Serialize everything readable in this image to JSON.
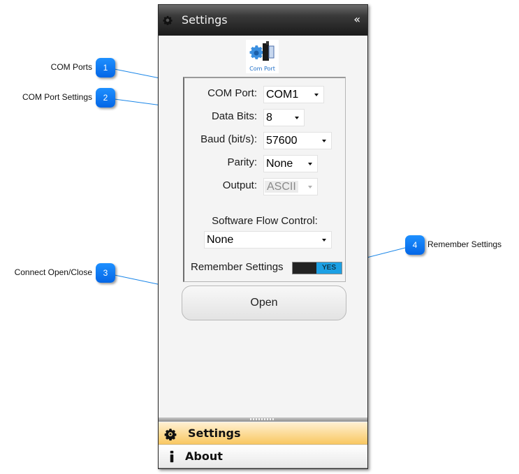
{
  "window": {
    "title": "Settings",
    "collapse_glyph": "«",
    "logo_caption": "Com Port",
    "logo_icon": "com-port-gear-icon"
  },
  "form": {
    "com_port": {
      "label": "COM Port:",
      "value": "COM1"
    },
    "data_bits": {
      "label": "Data Bits:",
      "value": "8"
    },
    "baud": {
      "label": "Baud (bit/s):",
      "value": "57600"
    },
    "parity": {
      "label": "Parity:",
      "value": "None"
    },
    "output": {
      "label": "Output:",
      "value": "ASCII",
      "disabled": true
    },
    "software_flow_control": {
      "label": "Software Flow Control:",
      "value": "None"
    },
    "remember_settings": {
      "label": "Remember Settings",
      "state": "YES"
    }
  },
  "open_button": {
    "label": "Open"
  },
  "nav": {
    "items": [
      {
        "label": "Settings",
        "icon": "gear-icon",
        "active": true
      },
      {
        "label": "About",
        "icon": "info-icon",
        "active": false
      }
    ]
  },
  "callouts": [
    {
      "number": "1",
      "text": "COM Ports"
    },
    {
      "number": "2",
      "text": "COM Port Settings"
    },
    {
      "number": "3",
      "text": "Connect Open/Close"
    },
    {
      "number": "4",
      "text": "Remember Settings"
    }
  ],
  "colors": {
    "callout_blue": "#0a78f0",
    "toggle_on": "#1ca0e4",
    "active_nav": "#f9c862"
  }
}
